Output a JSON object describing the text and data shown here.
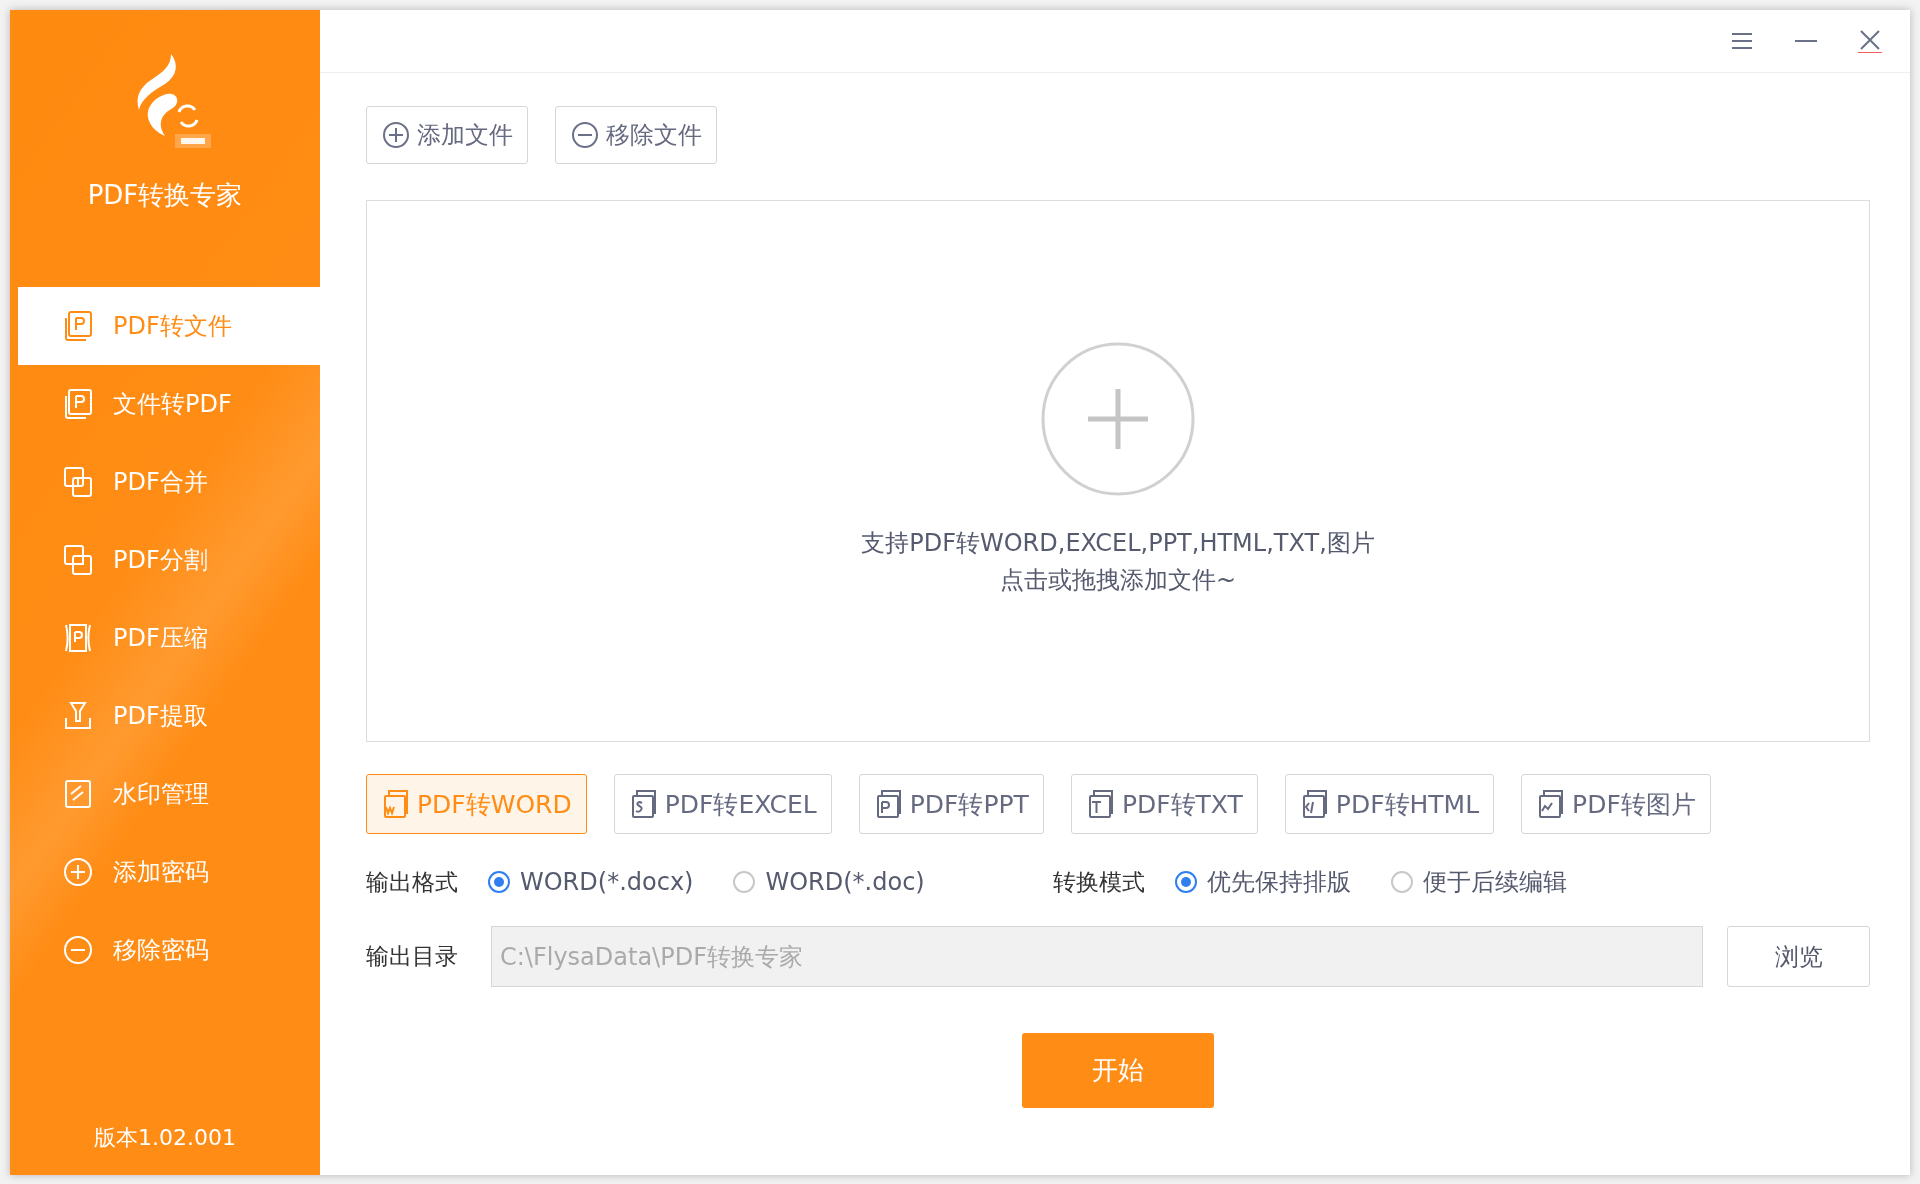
{
  "app": {
    "title": "PDF转换专家",
    "version": "版本1.02.001"
  },
  "sidebar": {
    "items": [
      {
        "label": "PDF转文件",
        "selected": true
      },
      {
        "label": "文件转PDF",
        "selected": false
      },
      {
        "label": "PDF合并",
        "selected": false
      },
      {
        "label": "PDF分割",
        "selected": false
      },
      {
        "label": "PDF压缩",
        "selected": false
      },
      {
        "label": "PDF提取",
        "selected": false
      },
      {
        "label": "水印管理",
        "selected": false
      },
      {
        "label": "添加密码",
        "selected": false
      },
      {
        "label": "移除密码",
        "selected": false
      }
    ]
  },
  "toolbar": [
    {
      "label": "添加文件",
      "kind": "add"
    },
    {
      "label": "移除文件",
      "kind": "remove"
    }
  ],
  "dropzone": {
    "lines": [
      "支持PDF转WORD,EXCEL,PPT,HTML,TXT,图片",
      "点击或拖拽添加文件~"
    ]
  },
  "formats": [
    {
      "label": "PDF转WORD",
      "selected": true
    },
    {
      "label": "PDF转EXCEL",
      "selected": false
    },
    {
      "label": "PDF转PPT",
      "selected": false
    },
    {
      "label": "PDF转TXT",
      "selected": false
    },
    {
      "label": "PDF转HTML",
      "selected": false
    },
    {
      "label": "PDF转图片",
      "selected": false
    }
  ],
  "option_groups": [
    {
      "label": "输出格式",
      "options": [
        {
          "label": "WORD(*.docx)",
          "selected": true
        },
        {
          "label": "WORD(*.doc)",
          "selected": false
        }
      ]
    },
    {
      "label": "转换模式",
      "options": [
        {
          "label": "优先保持排版",
          "selected": true
        },
        {
          "label": "便于后续编辑",
          "selected": false
        }
      ]
    }
  ],
  "output_dir": {
    "label": "输出目录",
    "value": "C:\\FlysaData\\PDF转换专家",
    "disabled": true,
    "browse": "浏览"
  },
  "start_button": "开始"
}
